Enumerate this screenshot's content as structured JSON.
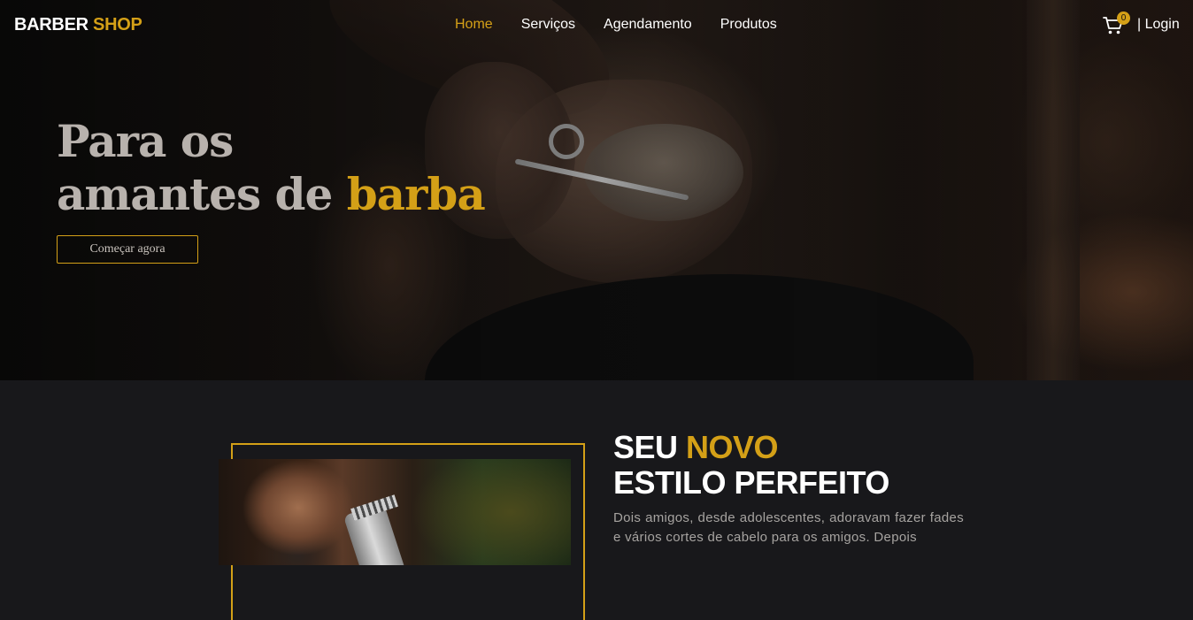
{
  "nav": {
    "logo_part1": "BARBER",
    "logo_part2": "SHOP",
    "items": [
      {
        "label": "Home",
        "active": true
      },
      {
        "label": "Serviços",
        "active": false
      },
      {
        "label": "Agendamento",
        "active": false
      },
      {
        "label": "Produtos",
        "active": false
      }
    ],
    "cart_icon": "shopping-cart-icon",
    "cart_count": "0",
    "login_label": "| Login"
  },
  "hero": {
    "title_line1": "Para os",
    "title_line2_prefix": "amantes de ",
    "title_line2_highlight": "barba",
    "cta_label": "Começar agora"
  },
  "about": {
    "heading_word1": "SEU ",
    "heading_word2": "NOVO",
    "heading_line2": "ESTILO PERFEITO",
    "paragraph": "Dois amigos, desde adolescentes, adoravam fazer fades e vários cortes de cabelo para os amigos. Depois"
  },
  "colors": {
    "accent": "#d4a017",
    "background": "#18181b",
    "text_light": "#ffffff",
    "text_muted": "#a6a3a0"
  }
}
